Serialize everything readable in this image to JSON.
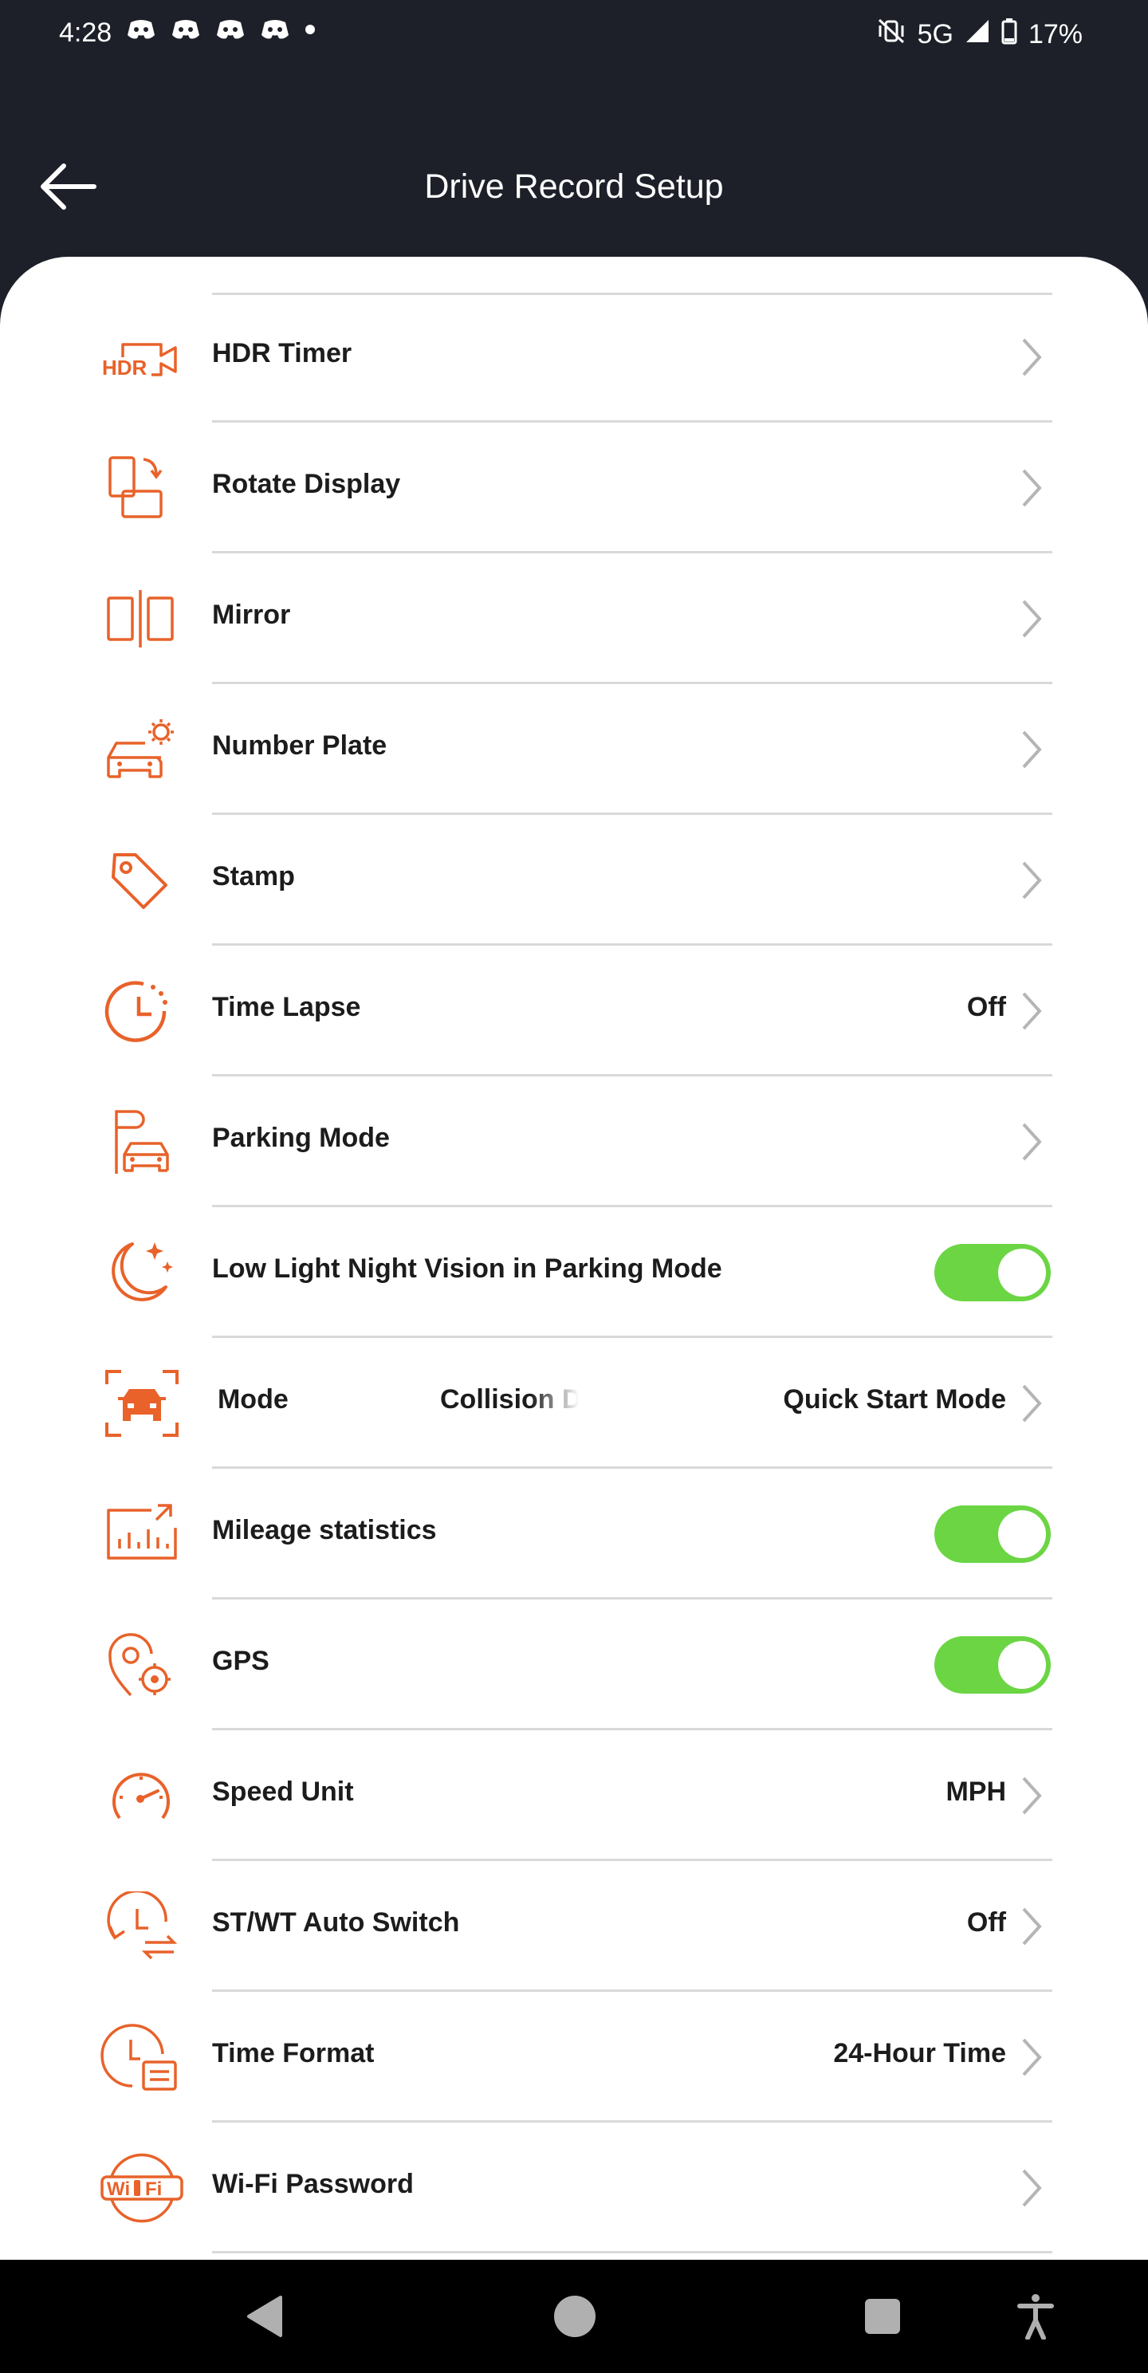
{
  "status_bar": {
    "time": "4:28",
    "network": "5G",
    "battery": "17%",
    "icons": [
      "discord-icon",
      "discord-icon",
      "discord-icon",
      "discord-icon",
      "dot-icon",
      "mute-vibrate-icon",
      "signal-icon",
      "battery-icon"
    ]
  },
  "app_bar": {
    "title": "Drive Record Setup"
  },
  "settings": [
    {
      "label": "HDR Timer",
      "icon": "hdr-camera-icon",
      "control": "chevron",
      "value": ""
    },
    {
      "label": "Rotate Display",
      "icon": "rotate-display-icon",
      "control": "chevron",
      "value": ""
    },
    {
      "label": "Mirror",
      "icon": "mirror-icon",
      "control": "chevron",
      "value": ""
    },
    {
      "label": "Number Plate",
      "icon": "car-gear-icon",
      "control": "chevron",
      "value": ""
    },
    {
      "label": "Stamp",
      "icon": "tag-icon",
      "control": "chevron",
      "value": ""
    },
    {
      "label": "Time Lapse",
      "icon": "time-lapse-icon",
      "control": "chevron",
      "value": "Off"
    },
    {
      "label": "Parking Mode",
      "icon": "parking-car-icon",
      "control": "chevron",
      "value": ""
    },
    {
      "label": "Low Light Night Vision in Parking Mode",
      "icon": "moon-stars-icon",
      "control": "toggle",
      "on": true
    },
    {
      "label": "",
      "icon": "car-frame-icon",
      "control": "chevron",
      "value": "Quick Start Mode",
      "marquee": [
        "ng Mode",
        "Collision D"
      ]
    },
    {
      "label": "Mileage statistics",
      "icon": "chart-icon",
      "control": "toggle",
      "on": true
    },
    {
      "label": "GPS",
      "icon": "gps-pin-icon",
      "control": "toggle",
      "on": true
    },
    {
      "label": "Speed Unit",
      "icon": "speedometer-icon",
      "control": "chevron",
      "value": "MPH"
    },
    {
      "label": "ST/WT Auto Switch",
      "icon": "clock-switch-icon",
      "control": "chevron",
      "value": "Off"
    },
    {
      "label": "Time Format",
      "icon": "clock-list-icon",
      "control": "chevron",
      "value": "24-Hour Time"
    },
    {
      "label": "Wi-Fi Password",
      "icon": "wifi-badge-icon",
      "control": "chevron",
      "value": ""
    }
  ],
  "nav_bar": {
    "buttons": [
      "back-triangle-icon",
      "home-circle-icon",
      "recents-square-icon",
      "accessibility-icon"
    ]
  },
  "colors": {
    "accent": "#e8622a",
    "toggle_on": "#6bd544",
    "header_bg": "#1d2029",
    "divider": "#d9d9d9",
    "text": "#1c1c1c"
  }
}
